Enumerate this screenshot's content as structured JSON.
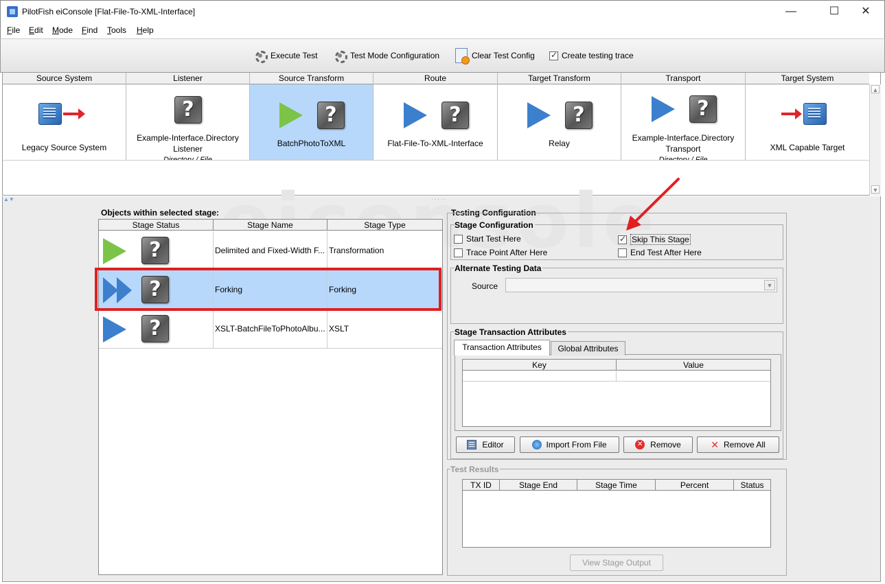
{
  "window": {
    "title": "PilotFish eiConsole [Flat-File-To-XML-Interface]",
    "minimize": "—",
    "maximize": "☐",
    "close": "✕"
  },
  "menu": {
    "items": [
      "File",
      "Edit",
      "Mode",
      "Find",
      "Tools",
      "Help"
    ]
  },
  "toolbar": {
    "execute_test": "Execute Test",
    "test_mode_configuration": "Test Mode Configuration",
    "clear_test_config": "Clear Test Config",
    "create_testing_trace": "Create testing trace",
    "create_testing_trace_checked": true
  },
  "stages": {
    "headers": [
      "Source System",
      "Listener",
      "Source Transform",
      "Route",
      "Target Transform",
      "Transport",
      "Target System"
    ],
    "source_system_label": "Legacy Source System",
    "listener_label_1": "Example-Interface.Directory",
    "listener_label_2": "Listener",
    "listener_sub": "Directory / File",
    "source_transform_label": "BatchPhotoToXML",
    "route_label": "Flat-File-To-XML-Interface",
    "target_transform_label": "Relay",
    "transport_label_1": "Example-Interface.Directory",
    "transport_label_2": "Transport",
    "transport_sub": "Directory / File",
    "target_system_label": "XML Capable Target",
    "selected": "Source Transform"
  },
  "watermark": "eiconsole",
  "objects": {
    "title": "Objects within selected stage:",
    "columns": [
      "Stage Status",
      "Stage Name",
      "Stage Type"
    ],
    "rows": [
      {
        "status": "start",
        "name": "Delimited and Fixed-Width F...",
        "type": "Transformation"
      },
      {
        "status": "skip",
        "name": "Forking",
        "type": "Forking"
      },
      {
        "status": "normal",
        "name": "XSLT-BatchFileToPhotoAlbu...",
        "type": "XSLT"
      }
    ]
  },
  "testing_config": {
    "title": "Testing Configuration",
    "stage_config_title": "Stage Configuration",
    "start_test_here": "Start Test Here",
    "skip_this_stage": "Skip This Stage",
    "trace_point_after_here": "Trace Point After Here",
    "end_test_after_here": "End Test After Here",
    "skip_checked": true,
    "alternate_data_title": "Alternate Testing Data",
    "source_label": "Source",
    "source_value": "",
    "attributes_title": "Stage Transaction Attributes",
    "tab_transaction": "Transaction Attributes",
    "tab_global": "Global Attributes",
    "kv_columns": [
      "Key",
      "Value"
    ],
    "editor": "Editor",
    "import_from_file": "Import From File",
    "remove": "Remove",
    "remove_all": "Remove All"
  },
  "test_results": {
    "title": "Test Results",
    "columns": [
      "TX ID",
      "Stage End",
      "Stage Time",
      "Percent",
      "Status"
    ],
    "view_stage_output": "View Stage Output"
  },
  "colors": {
    "selection": "#b8d8fb",
    "highlight": "#e02020",
    "play_green": "#7cc447",
    "play_blue": "#3c7fcd"
  }
}
